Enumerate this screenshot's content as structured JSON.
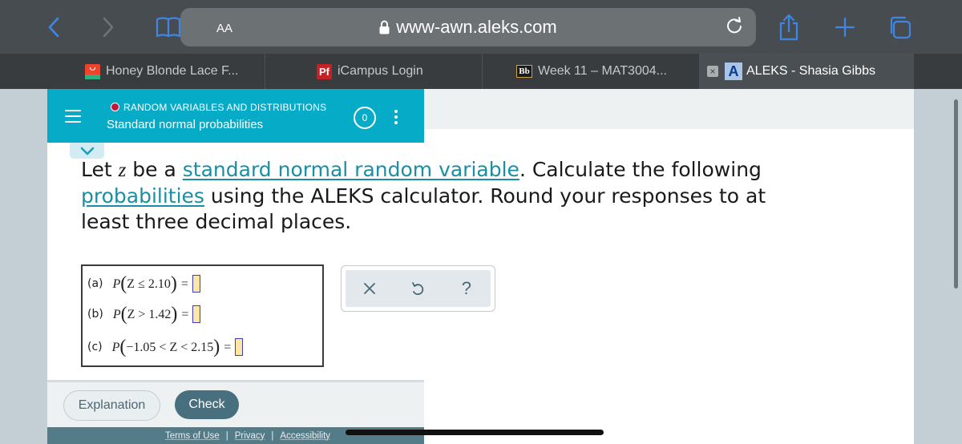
{
  "browser": {
    "text_size_label": "AA",
    "url": "www-awn.aleks.com",
    "colors": {
      "accent": "#3e86e6",
      "toolbar_bg": "#474c50",
      "tabbar_bg": "#383c3f"
    }
  },
  "tabs": [
    {
      "title": "Honey Blonde Lace F...",
      "favicon": "shopping-bag-favicon",
      "active": false
    },
    {
      "title": "iCampus Login",
      "favicon": "Pf",
      "active": false
    },
    {
      "title": "Week 11 – MAT3004...",
      "favicon": "Bb",
      "active": false
    },
    {
      "title": "ALEKS - Shasia Gibbs",
      "favicon": "A",
      "active": true,
      "close_icon": "×"
    }
  ],
  "topic": {
    "category": "RANDOM VARIABLES AND DISTRIBUTIONS",
    "title": "Standard normal probabilities",
    "score": "0",
    "colors": {
      "bar": "#06acc7",
      "status_dot": "#c3163e"
    }
  },
  "question": {
    "pre": "Let ",
    "var": "z",
    "mid1": " be a ",
    "link1": "standard normal random variable",
    "mid2": ". Calculate the following ",
    "link2": "probabilities",
    "post": " using the ALEKS calculator. Round your responses to at least three decimal places."
  },
  "answers": [
    {
      "label": "(a)",
      "p": "P",
      "open": "(",
      "expr": "Z ≤ 2.10",
      "close": ")",
      "eq": "=",
      "value": ""
    },
    {
      "label": "(b)",
      "p": "P",
      "open": "(",
      "expr": "Z > 1.42",
      "close": ")",
      "eq": "=",
      "value": ""
    },
    {
      "label": "(c)",
      "p": "P",
      "open": "(",
      "expr": "−1.05 < Z < 2.15",
      "close": ")",
      "eq": "=",
      "value": ""
    }
  ],
  "tools": {
    "clear": "×",
    "undo": "undo",
    "help": "?"
  },
  "buttons": {
    "explanation": "Explanation",
    "check": "Check"
  },
  "footer": {
    "terms": "Terms of Use",
    "privacy": "Privacy",
    "accessibility": "Accessibility",
    "sep": "|"
  }
}
